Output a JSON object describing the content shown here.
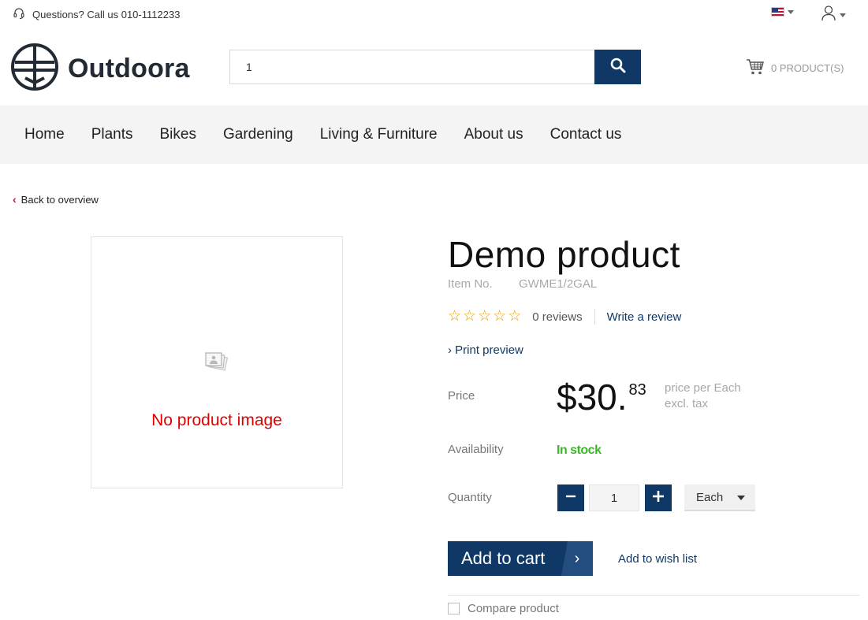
{
  "topbar": {
    "phone_text": "Questions? Call us 010-1112233",
    "icons": {
      "support": "headset-icon",
      "flag": "us-flag-icon",
      "user": "user-icon"
    }
  },
  "header": {
    "logo_text": "Outdoora",
    "search_value": "1",
    "search_icon": "search-icon",
    "cart_text": "0 PRODUCT(S)"
  },
  "nav": {
    "items": [
      "Home",
      "Plants",
      "Bikes",
      "Gardening",
      "Living & Furniture",
      "About us",
      "Contact us"
    ]
  },
  "breadcrumb": {
    "back_label": "Back to overview"
  },
  "image": {
    "no_image_text": "No product image"
  },
  "product": {
    "title": "Demo product",
    "item_no_label": "Item No.",
    "item_no": "GWME1/2GAL",
    "stars_max": 5,
    "stars_filled": 0,
    "reviews_text": "0 reviews",
    "write_review": "Write a review",
    "print_preview": "Print preview",
    "price_label": "Price",
    "price_main": "$30.",
    "price_cents": "83",
    "price_note_line1": "price per Each",
    "price_note_line2": "excl. tax",
    "availability_label": "Availability",
    "availability_value": "In stock",
    "quantity_label": "Quantity",
    "quantity_value": "1",
    "unit": "Each",
    "add_to_cart": "Add to cart",
    "add_to_wishlist": "Add to wish list",
    "compare": "Compare product"
  },
  "colors": {
    "brand_navy": "#0f3866",
    "in_stock_green": "#3db529",
    "no_image_red": "#e00000",
    "star_gold": "#e8a300"
  }
}
